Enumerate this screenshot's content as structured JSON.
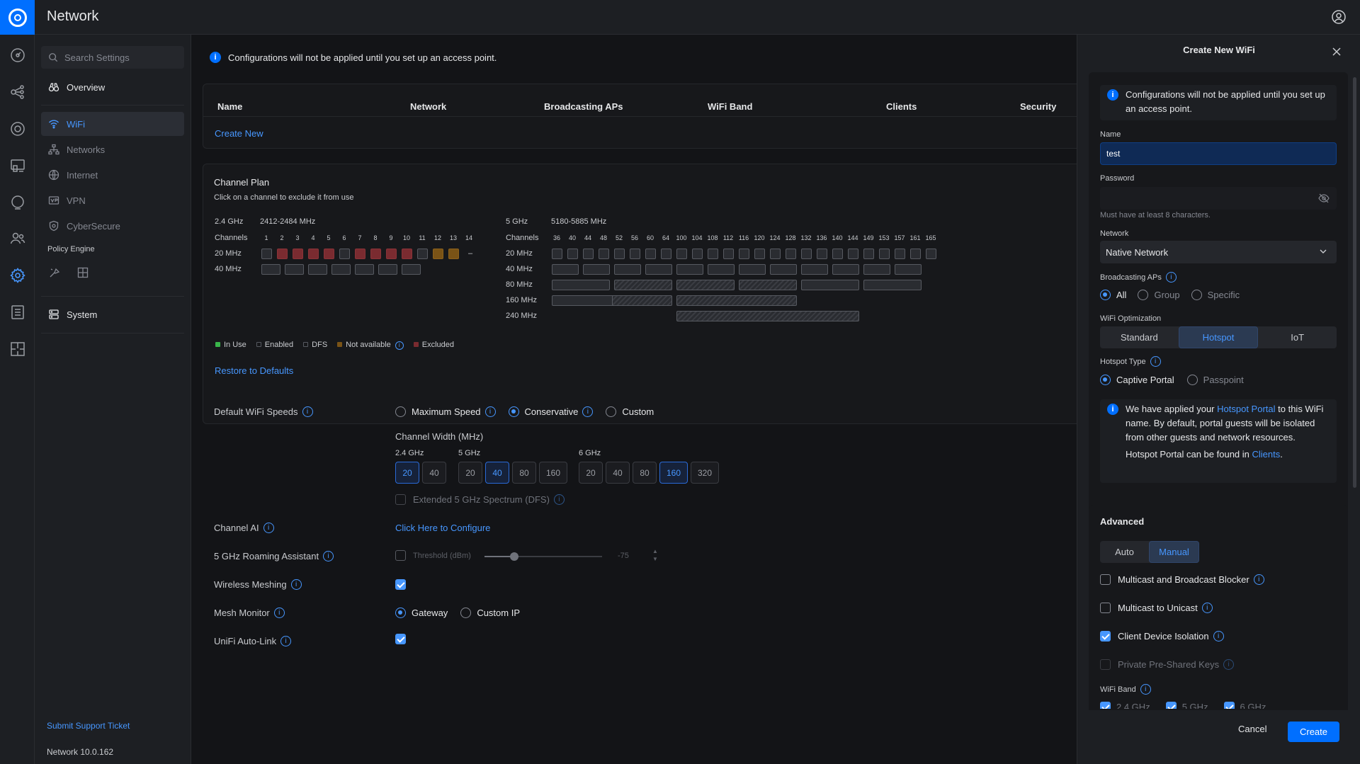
{
  "app": {
    "title": "Network"
  },
  "sidebar": {
    "search_placeholder": "Search Settings",
    "items": [
      {
        "label": "Overview"
      },
      {
        "label": "WiFi"
      },
      {
        "label": "Networks"
      },
      {
        "label": "Internet"
      },
      {
        "label": "VPN"
      },
      {
        "label": "CyberSecure"
      }
    ],
    "policy_engine_label": "Policy Engine",
    "system_label": "System",
    "support_link": "Submit Support Ticket",
    "version": "Network 10.0.162"
  },
  "main": {
    "banner": "Configurations will not be applied until you set up an access point.",
    "table": {
      "headers": [
        "Name",
        "Network",
        "Broadcasting APs",
        "WiFi Band",
        "Clients",
        "Security"
      ],
      "create_new": "Create New"
    },
    "channel_plan": {
      "title": "Channel Plan",
      "subtitle": "Click on a channel to exclude it from use",
      "band24": {
        "label": "2.4 GHz",
        "range": "2412-2484 MHz",
        "channels_label": "Channels",
        "channels": [
          "1",
          "2",
          "3",
          "4",
          "5",
          "6",
          "7",
          "8",
          "9",
          "10",
          "11",
          "12",
          "13",
          "14"
        ],
        "row20": "20 MHz",
        "row40": "40 MHz",
        "status20": [
          "enabled",
          "excluded",
          "excluded",
          "excluded",
          "excluded",
          "enabled",
          "excluded",
          "excluded",
          "excluded",
          "excluded",
          "enabled",
          "not-available",
          "not-available",
          "none"
        ],
        "dash": "–"
      },
      "band5": {
        "label": "5 GHz",
        "range": "5180-5885 MHz",
        "channels_label": "Channels",
        "channels": [
          "36",
          "40",
          "44",
          "48",
          "52",
          "56",
          "60",
          "64",
          "100",
          "104",
          "108",
          "112",
          "116",
          "120",
          "124",
          "128",
          "132",
          "136",
          "140",
          "144",
          "149",
          "153",
          "157",
          "161",
          "165"
        ],
        "rows": [
          "20 MHz",
          "40 MHz",
          "80 MHz",
          "160 MHz",
          "240 MHz"
        ]
      },
      "legend": [
        {
          "label": "In Use",
          "color": "#39b54a"
        },
        {
          "label": "Enabled",
          "color": "#575a61"
        },
        {
          "label": "DFS",
          "color": "#575a61"
        },
        {
          "label": "Not available",
          "color": "#7a5316"
        },
        {
          "label": "Excluded",
          "color": "#7a2b30"
        }
      ],
      "restore": "Restore to Defaults"
    },
    "speeds": {
      "label": "Default WiFi Speeds",
      "options": [
        "Maximum Speed",
        "Conservative",
        "Custom"
      ],
      "selected": "Conservative",
      "channel_width_label": "Channel Width (MHz)",
      "g24": {
        "label": "2.4 GHz",
        "values": [
          "20",
          "40"
        ],
        "selected": "20"
      },
      "g5": {
        "label": "5 GHz",
        "values": [
          "20",
          "40",
          "80",
          "160"
        ],
        "selected": "40"
      },
      "g6": {
        "label": "6 GHz",
        "values": [
          "20",
          "40",
          "80",
          "160",
          "320"
        ],
        "selected": "160"
      },
      "extended": "Extended 5 GHz Spectrum (DFS)"
    },
    "channel_ai": {
      "label": "Channel AI",
      "link": "Click Here to Configure"
    },
    "roaming": {
      "label": "5 GHz Roaming Assistant",
      "threshold_label": "Threshold (dBm)",
      "value": "-75",
      "slider_fraction": 0.25
    },
    "meshing": {
      "label": "Wireless Meshing",
      "checked": true
    },
    "mesh_monitor": {
      "label": "Mesh Monitor",
      "options": [
        "Gateway",
        "Custom IP"
      ],
      "selected": "Gateway"
    },
    "autolink": {
      "label": "UniFi Auto-Link",
      "checked": true
    }
  },
  "panel": {
    "title": "Create New WiFi",
    "info": "Configurations will not be applied until you set up an access point.",
    "name_label": "Name",
    "name_value": "test",
    "password_label": "Password",
    "password_hint": "Must have at least 8 characters.",
    "network_label": "Network",
    "network_value": "Native Network",
    "broadcasting_label": "Broadcasting APs",
    "broadcasting_options": [
      "All",
      "Group",
      "Specific"
    ],
    "optimization_label": "WiFi Optimization",
    "optimization_options": [
      "Standard",
      "Hotspot",
      "IoT"
    ],
    "hotspot_type_label": "Hotspot Type",
    "hotspot_options": [
      "Captive Portal",
      "Passpoint"
    ],
    "hotspot_info_1": "We have applied your",
    "hotspot_info_link": "Hotspot Portal",
    "hotspot_info_2": "to this WiFi name. By default, portal guests will be isolated from other guests and network resources.",
    "hotspot_info_3": "Hotspot Portal can be found in",
    "hotspot_info_link2": "Clients",
    "hotspot_info_period": ".",
    "advanced_label": "Advanced",
    "advanced_options": [
      "Auto",
      "Manual"
    ],
    "checks": [
      {
        "label": "Multicast and Broadcast Blocker",
        "checked": false
      },
      {
        "label": "Multicast to Unicast",
        "checked": false
      },
      {
        "label": "Client Device Isolation",
        "checked": true
      },
      {
        "label": "Private Pre-Shared Keys",
        "checked": false
      }
    ],
    "band_label": "WiFi Band",
    "bands": [
      "2.4 GHz",
      "5 GHz",
      "6 GHz"
    ],
    "cancel": "Cancel",
    "create": "Create"
  }
}
